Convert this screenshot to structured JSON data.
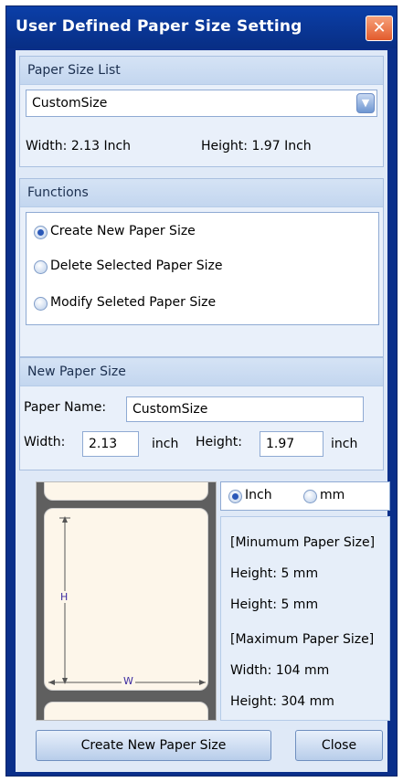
{
  "window": {
    "title": "User Defined Paper Size Setting",
    "close_glyph": "✕"
  },
  "paper_size_list": {
    "header": "Paper Size List",
    "selected": "CustomSize",
    "width_text": "Width: 2.13 Inch",
    "height_text": "Height: 1.97 Inch"
  },
  "functions": {
    "header": "Functions",
    "options": [
      {
        "label": "Create New Paper Size",
        "selected": true
      },
      {
        "label": "Delete Selected Paper Size",
        "selected": false
      },
      {
        "label": "Modify Seleted Paper Size",
        "selected": false
      }
    ]
  },
  "new_paper_size": {
    "header": "New Paper Size",
    "name_label": "Paper Name:",
    "name_value": "CustomSize",
    "width_label": "Width:",
    "width_value": "2.13",
    "width_unit": "inch",
    "height_label": "Height:",
    "height_value": "1.97",
    "height_unit": "inch"
  },
  "preview": {
    "h_label": "H",
    "w_label": "W"
  },
  "units": {
    "options": [
      {
        "label": "Inch",
        "selected": true
      },
      {
        "label": "mm",
        "selected": false
      }
    ]
  },
  "limits": {
    "min_title": "[Minumum Paper Size]",
    "min_height1": "Height: 5 mm",
    "min_height2": "Height: 5 mm",
    "max_title": "[Maximum Paper Size]",
    "max_width": "Width: 104 mm",
    "max_height": "Height: 304 mm"
  },
  "buttons": {
    "create": "Create New Paper Size",
    "close": "Close"
  },
  "colors": {
    "title_bar": "#0b3fa8",
    "close_button": "#e25b2c",
    "panel": "#dfe9f7"
  }
}
